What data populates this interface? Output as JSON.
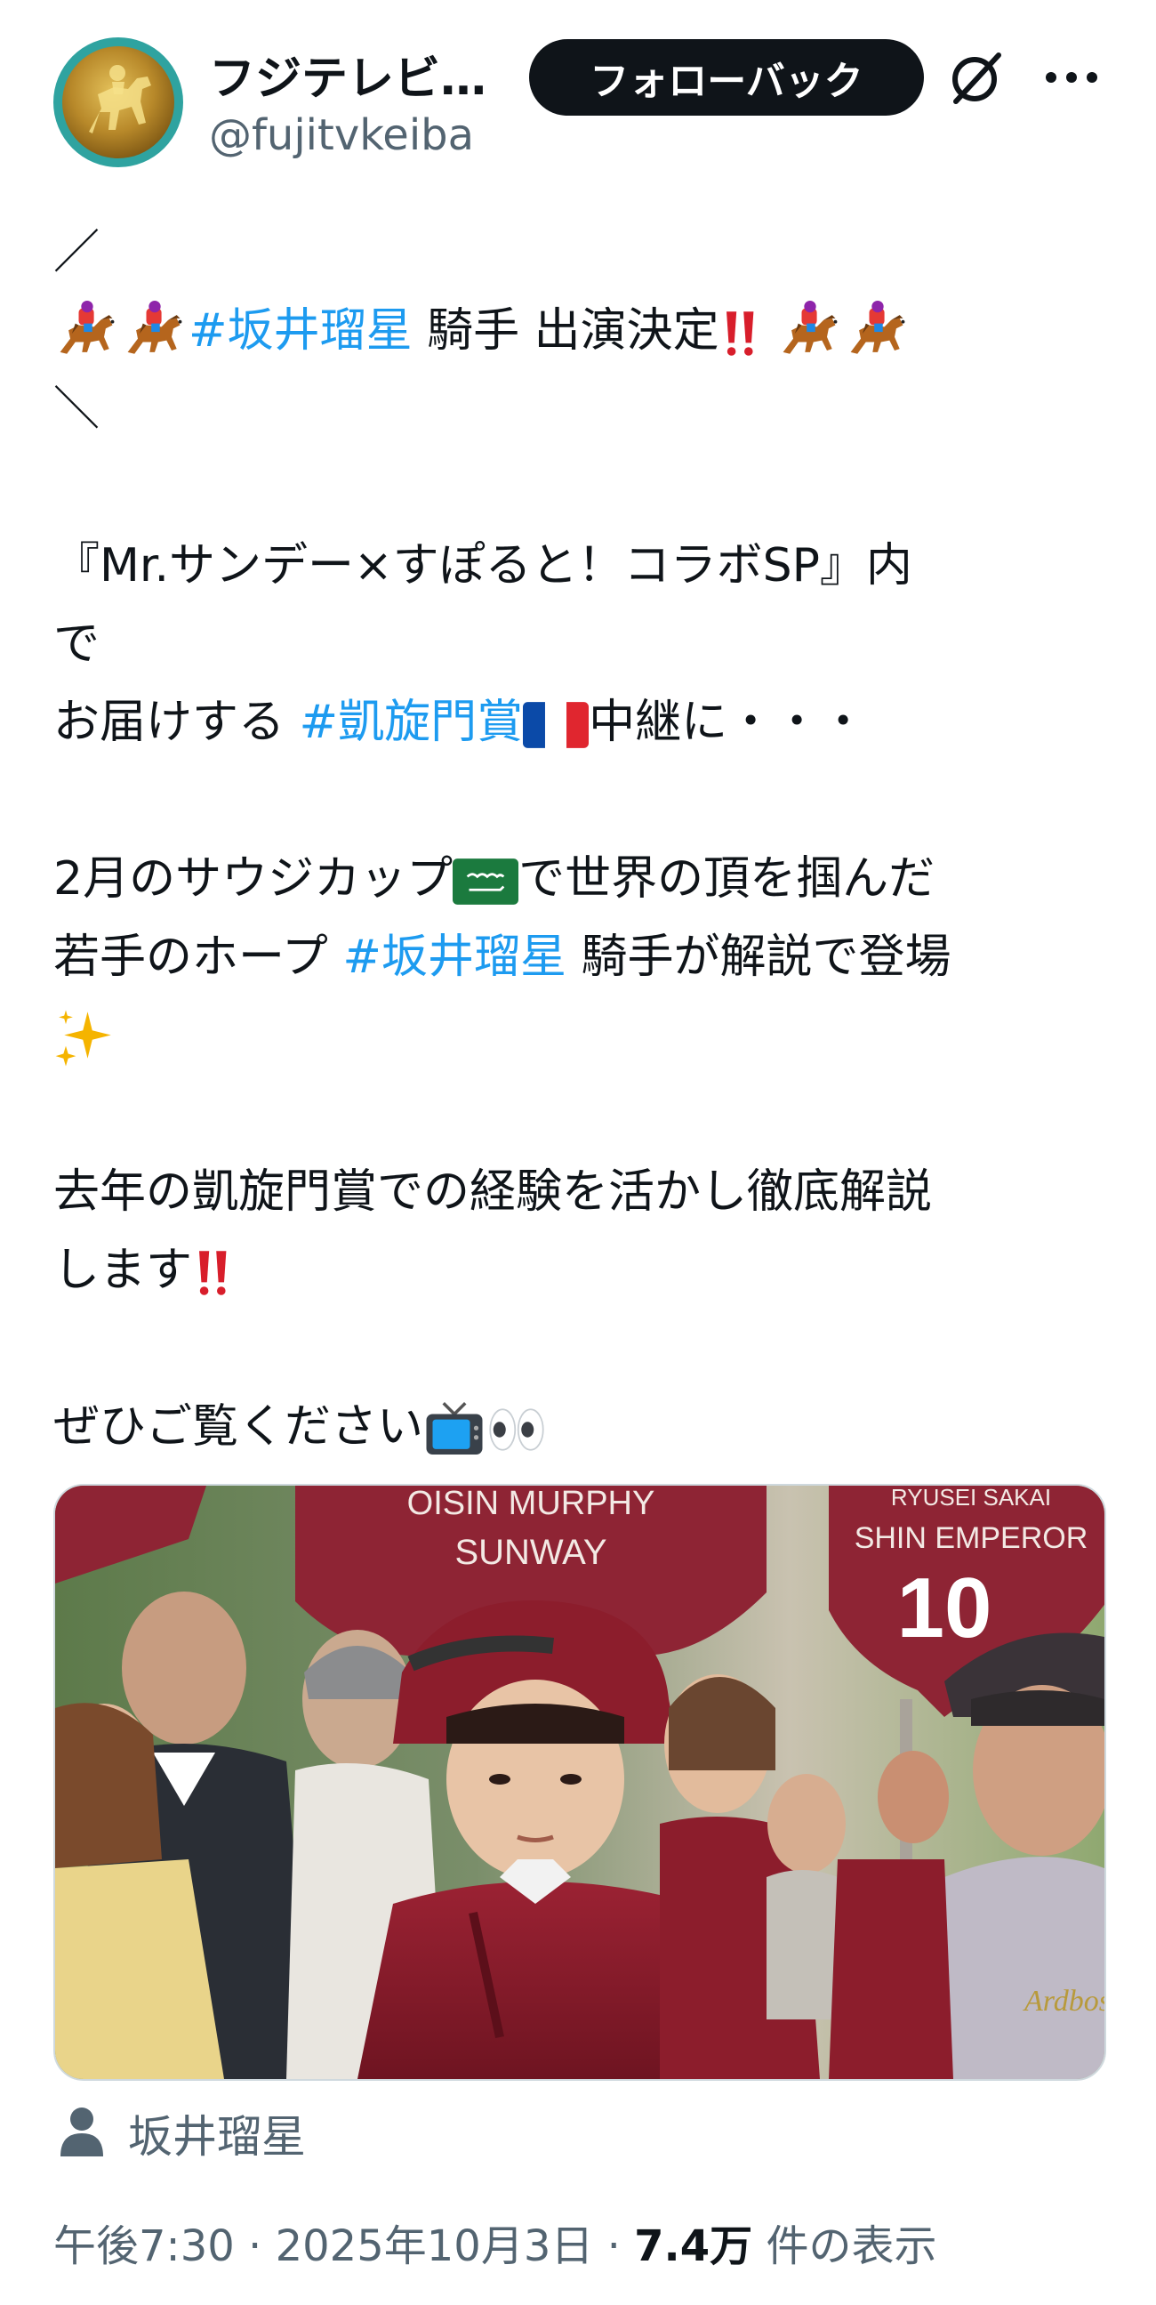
{
  "header": {
    "display_name": "フジテレビ…",
    "handle": "@fujitvkeiba",
    "follow_button": "フォローバック",
    "grok_icon": "grok-icon",
    "more_icon": "more-dots-icon"
  },
  "tweet": {
    "open_slash": "／",
    "headline_hashtag": "#坂井瑠星",
    "headline_text": " 騎手 出演決定",
    "close_slash": "＼",
    "line_program": "『Mr.サンデー×すぽると！コラボSP』内",
    "line_de": "で",
    "line_deliver": "お届けする ",
    "hashtag_gaisen": "#凱旋門賞",
    "line_relay": "中継に・・・",
    "line_saudi_a": "2月のサウジカップ",
    "line_saudi_b": "で世界の頂を掴んだ",
    "line_hope": "若手のホープ ",
    "hashtag_sakai": "#坂井瑠星",
    "line_hope_b": " 騎手が解説で登場",
    "line_last_year": "去年の凱旋門賞での経験を活かし徹底解説",
    "line_shimasu": "します",
    "line_please": "ぜひご覧ください",
    "emojis": {
      "horse_racing": "horse-racing-emoji",
      "double_exclamation": "double-exclamation-emoji",
      "france_flag": "france-flag-emoji",
      "saudi_flag": "saudi-flag-emoji",
      "sparkles": "sparkles-emoji",
      "tv": "tv-emoji",
      "eyes": "eyes-emoji"
    }
  },
  "media": {
    "sign_left_line1": "OISIN MURPHY",
    "sign_left_line2": "SUNWAY",
    "sign_right_line0": "RYUSEI SAKAI",
    "sign_right_line1": "SHIN EMPEROR",
    "sign_right_number": "10",
    "silk_text": "Ardbose"
  },
  "tag": {
    "icon": "person-icon",
    "name": "坂井瑠星"
  },
  "meta": {
    "time": "午後7:30",
    "sep1": " · ",
    "date": "2025年10月3日",
    "sep2": " · ",
    "views": "7.4万",
    "views_label": " 件の表示"
  },
  "colors": {
    "text": "#0f1419",
    "secondary": "#536471",
    "link": "#1d9bf0",
    "button_bg": "#0f1419",
    "jockey_silk": "#8c1d2c"
  }
}
